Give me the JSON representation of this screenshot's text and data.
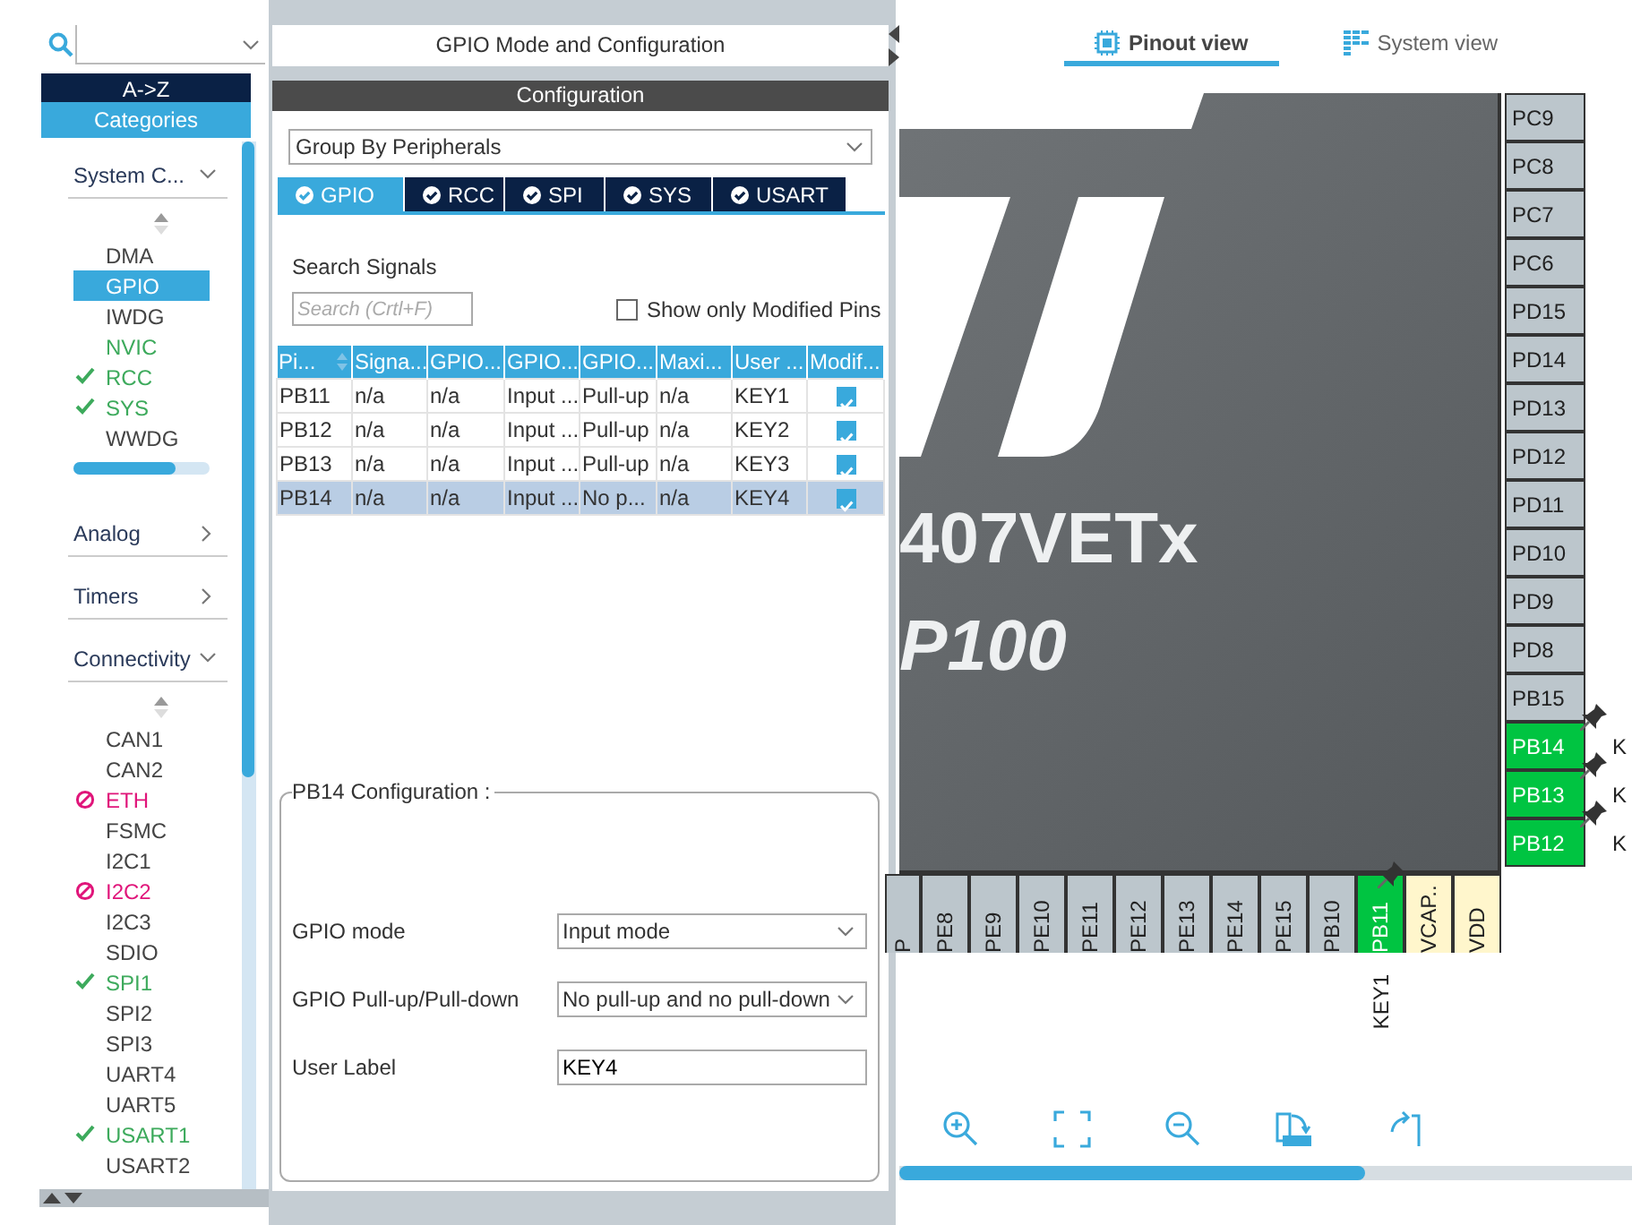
{
  "sidebar": {
    "sort_tabs": [
      {
        "label": "A->Z",
        "selected": false
      },
      {
        "label": "Categories",
        "selected": true
      }
    ],
    "groups": [
      {
        "label": "System C...",
        "expanded": true,
        "items": [
          {
            "label": "DMA",
            "kind": "plain",
            "selected": false
          },
          {
            "label": "GPIO",
            "kind": "plain",
            "selected": true
          },
          {
            "label": "IWDG",
            "kind": "plain",
            "selected": false
          },
          {
            "label": "NVIC",
            "kind": "enabled",
            "selected": false
          },
          {
            "label": "RCC",
            "kind": "configured",
            "selected": false
          },
          {
            "label": "SYS",
            "kind": "configured",
            "selected": false
          },
          {
            "label": "WWDG",
            "kind": "plain",
            "selected": false
          }
        ]
      },
      {
        "label": "Analog",
        "expanded": false
      },
      {
        "label": "Timers",
        "expanded": false
      },
      {
        "label": "Connectivity",
        "expanded": true,
        "items": [
          {
            "label": "CAN1",
            "kind": "plain",
            "selected": false
          },
          {
            "label": "CAN2",
            "kind": "plain",
            "selected": false
          },
          {
            "label": "ETH",
            "kind": "conflict",
            "selected": false
          },
          {
            "label": "FSMC",
            "kind": "plain",
            "selected": false
          },
          {
            "label": "I2C1",
            "kind": "plain",
            "selected": false
          },
          {
            "label": "I2C2",
            "kind": "conflict",
            "selected": false
          },
          {
            "label": "I2C3",
            "kind": "plain",
            "selected": false
          },
          {
            "label": "SDIO",
            "kind": "plain",
            "selected": false
          },
          {
            "label": "SPI1",
            "kind": "configured",
            "selected": false
          },
          {
            "label": "SPI2",
            "kind": "plain",
            "selected": false
          },
          {
            "label": "SPI3",
            "kind": "plain",
            "selected": false
          },
          {
            "label": "UART4",
            "kind": "plain",
            "selected": false
          },
          {
            "label": "UART5",
            "kind": "plain",
            "selected": false
          },
          {
            "label": "USART1",
            "kind": "configured",
            "selected": false
          },
          {
            "label": "USART2",
            "kind": "plain",
            "selected": false
          }
        ]
      }
    ]
  },
  "panel": {
    "title": "GPIO Mode and Configuration",
    "section": "Configuration",
    "group_by": "Group By Peripherals",
    "tabs": [
      {
        "label": "GPIO",
        "selected": true
      },
      {
        "label": "RCC",
        "selected": false
      },
      {
        "label": "SPI",
        "selected": false
      },
      {
        "label": "SYS",
        "selected": false
      },
      {
        "label": "USART",
        "selected": false
      }
    ],
    "search": {
      "label": "Search Signals",
      "placeholder": "Search (Crtl+F)"
    },
    "modified_only": {
      "label": "Show only Modified Pins",
      "checked": false
    },
    "table": {
      "columns": [
        "Pi...",
        "Signa...",
        "GPIO...",
        "GPIO...",
        "GPIO...",
        "Maxi...",
        "User ...",
        "Modif..."
      ],
      "rows": [
        {
          "cells": [
            "PB11",
            "n/a",
            "n/a",
            "Input ...",
            "Pull-up",
            "n/a",
            "KEY1"
          ],
          "modified": true,
          "selected": false
        },
        {
          "cells": [
            "PB12",
            "n/a",
            "n/a",
            "Input ...",
            "Pull-up",
            "n/a",
            "KEY2"
          ],
          "modified": true,
          "selected": false
        },
        {
          "cells": [
            "PB13",
            "n/a",
            "n/a",
            "Input ...",
            "Pull-up",
            "n/a",
            "KEY3"
          ],
          "modified": true,
          "selected": false
        },
        {
          "cells": [
            "PB14",
            "n/a",
            "n/a",
            "Input ...",
            "No p...",
            "n/a",
            "KEY4"
          ],
          "modified": true,
          "selected": true
        }
      ]
    },
    "pin_config": {
      "title": "PB14 Configuration :",
      "fields": [
        {
          "kind": "select",
          "label": "GPIO mode",
          "value": "Input mode"
        },
        {
          "kind": "select",
          "label": "GPIO Pull-up/Pull-down",
          "value": "No pull-up and no pull-down"
        },
        {
          "kind": "text",
          "label": "User Label",
          "value": "KEY4"
        }
      ]
    }
  },
  "view_tabs": [
    {
      "label": "Pinout view",
      "selected": true
    },
    {
      "label": "System view",
      "selected": false
    }
  ],
  "chip": {
    "part": "407VETx",
    "package": "P100",
    "right_pins": [
      {
        "name": "PC9",
        "kind": "default",
        "locked": false
      },
      {
        "name": "PC8",
        "kind": "default",
        "locked": false
      },
      {
        "name": "PC7",
        "kind": "default",
        "locked": false
      },
      {
        "name": "PC6",
        "kind": "default",
        "locked": false
      },
      {
        "name": "PD15",
        "kind": "default",
        "locked": false
      },
      {
        "name": "PD14",
        "kind": "default",
        "locked": false
      },
      {
        "name": "PD13",
        "kind": "default",
        "locked": false
      },
      {
        "name": "PD12",
        "kind": "default",
        "locked": false
      },
      {
        "name": "PD11",
        "kind": "default",
        "locked": false
      },
      {
        "name": "PD10",
        "kind": "default",
        "locked": false
      },
      {
        "name": "PD9",
        "kind": "default",
        "locked": false
      },
      {
        "name": "PD8",
        "kind": "default",
        "locked": false
      },
      {
        "name": "PB15",
        "kind": "default",
        "locked": false
      },
      {
        "name": "PB14",
        "kind": "signal",
        "locked": true,
        "label": "K"
      },
      {
        "name": "PB13",
        "kind": "signal",
        "locked": true,
        "label": "K"
      },
      {
        "name": "PB12",
        "kind": "signal",
        "locked": true,
        "label": "K"
      }
    ],
    "bottom_pins": [
      {
        "name": "P",
        "kind": "default",
        "locked": false
      },
      {
        "name": "PE8",
        "kind": "default",
        "locked": false
      },
      {
        "name": "PE9",
        "kind": "default",
        "locked": false
      },
      {
        "name": "PE10",
        "kind": "default",
        "locked": false
      },
      {
        "name": "PE11",
        "kind": "default",
        "locked": false
      },
      {
        "name": "PE12",
        "kind": "default",
        "locked": false
      },
      {
        "name": "PE13",
        "kind": "default",
        "locked": false
      },
      {
        "name": "PE14",
        "kind": "default",
        "locked": false
      },
      {
        "name": "PE15",
        "kind": "default",
        "locked": false
      },
      {
        "name": "PB10",
        "kind": "default",
        "locked": false
      },
      {
        "name": "PB11",
        "kind": "signal",
        "locked": true,
        "label": "KEY1"
      },
      {
        "name": "VCAP..",
        "kind": "power",
        "locked": false
      },
      {
        "name": "VDD",
        "kind": "power",
        "locked": false
      }
    ]
  }
}
